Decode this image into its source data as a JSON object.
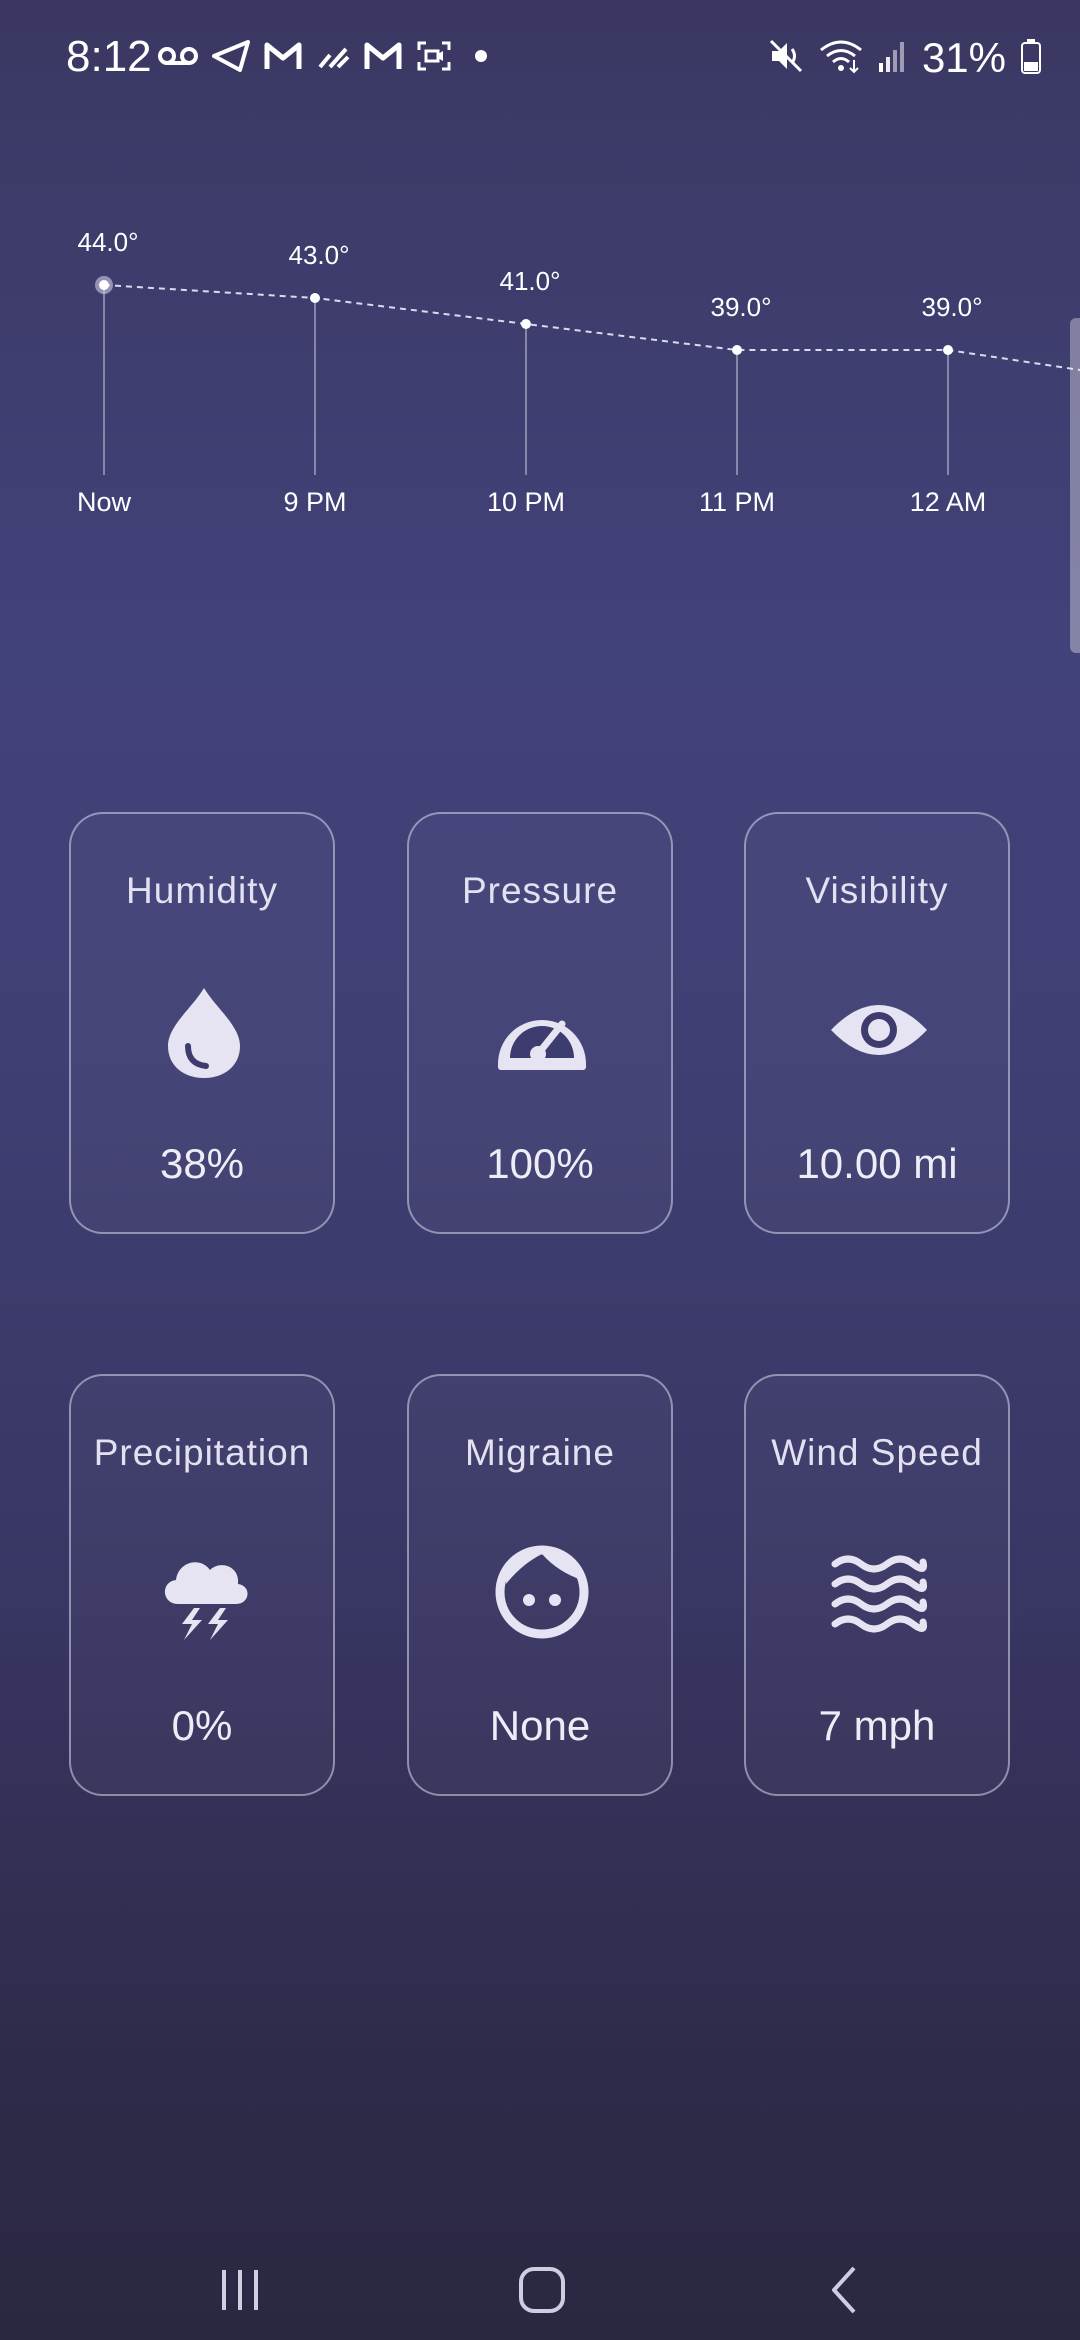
{
  "status_bar": {
    "time": "8:12",
    "battery_percent": "31%",
    "left_icons": [
      "voicemail-icon",
      "send-icon",
      "gmail-icon",
      "sparkle-icon",
      "gmail-icon",
      "screen-record-icon",
      "dot-icon"
    ],
    "right_icons": [
      "mute-icon",
      "wifi-icon",
      "signal-icon",
      "battery-icon"
    ]
  },
  "hourly": {
    "items": [
      {
        "time": "Now",
        "temp_label": "44.0°",
        "temp": 44.0
      },
      {
        "time": "9 PM",
        "temp_label": "43.0°",
        "temp": 43.0
      },
      {
        "time": "10 PM",
        "temp_label": "41.0°",
        "temp": 41.0
      },
      {
        "time": "11 PM",
        "temp_label": "39.0°",
        "temp": 39.0
      },
      {
        "time": "12 AM",
        "temp_label": "39.0°",
        "temp": 39.0
      }
    ]
  },
  "cards": [
    {
      "title": "Humidity",
      "value": "38%",
      "icon": "water-drop-icon"
    },
    {
      "title": "Pressure",
      "value": "100%",
      "icon": "speedometer-icon"
    },
    {
      "title": "Visibility",
      "value": "10.00 mi",
      "icon": "eye-icon"
    },
    {
      "title": "Precipitation",
      "value": "0%",
      "icon": "thunderstorm-icon"
    },
    {
      "title": "Migraine",
      "value": "None",
      "icon": "face-icon"
    },
    {
      "title": "Wind Speed",
      "value": "7 mph",
      "icon": "wind-waves-icon"
    }
  ],
  "colors": {
    "background_top": "#3a3862",
    "background_bottom": "#2a2742",
    "card_border": "#bdbbd6",
    "icon": "#e6e4f2"
  }
}
